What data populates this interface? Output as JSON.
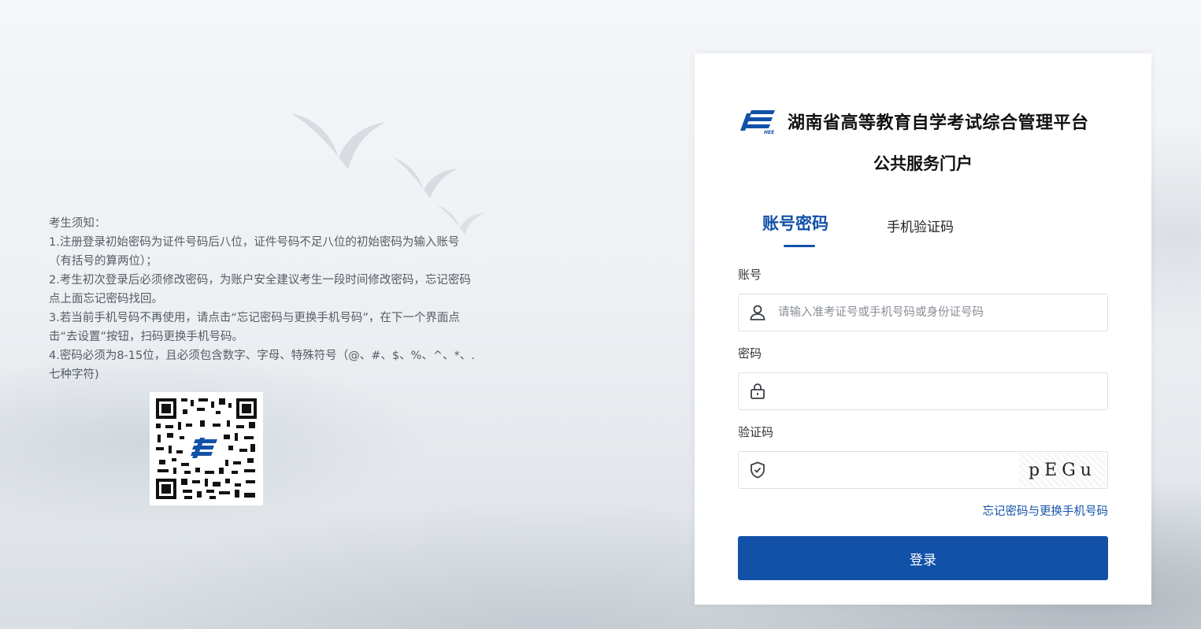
{
  "notice": {
    "heading": "考生须知：",
    "lines": [
      "1.注册登录初始密码为证件号码后八位，证件号码不足八位的初始密码为输入账号（有括号的算两位）；",
      "2.考生初次登录后必须修改密码，为账户安全建议考生一段时间修改密码，忘记密码点上面忘记密码找回。",
      "3.若当前手机号码不再使用，请点击“忘记密码与更换手机号码”，在下一个界面点击“去设置”按钮，扫码更换手机号码。",
      "4.密码必须为8-15位，且必须包含数字、字母、特殊符号（@、#、$、%、^、*、.七种字符)"
    ]
  },
  "qr": {
    "icon": "qr-code"
  },
  "header": {
    "logo_icon": "exam-logo",
    "title": "湖南省高等教育自学考试综合管理平台",
    "subtitle": "公共服务门户"
  },
  "tabs": [
    {
      "label": "账号密码",
      "active": true
    },
    {
      "label": "手机验证码",
      "active": false
    }
  ],
  "form": {
    "account_label": "账号",
    "account_placeholder": "请输入准考证号或手机号码或身份证号码",
    "account_value": "",
    "password_label": "密码",
    "password_value": "",
    "captcha_label": "验证码",
    "captcha_value": "",
    "captcha_text": "pEGu",
    "forgot_link": "忘记密码与更换手机号码",
    "login_label": "登录"
  },
  "colors": {
    "accent": "#1251a8"
  }
}
